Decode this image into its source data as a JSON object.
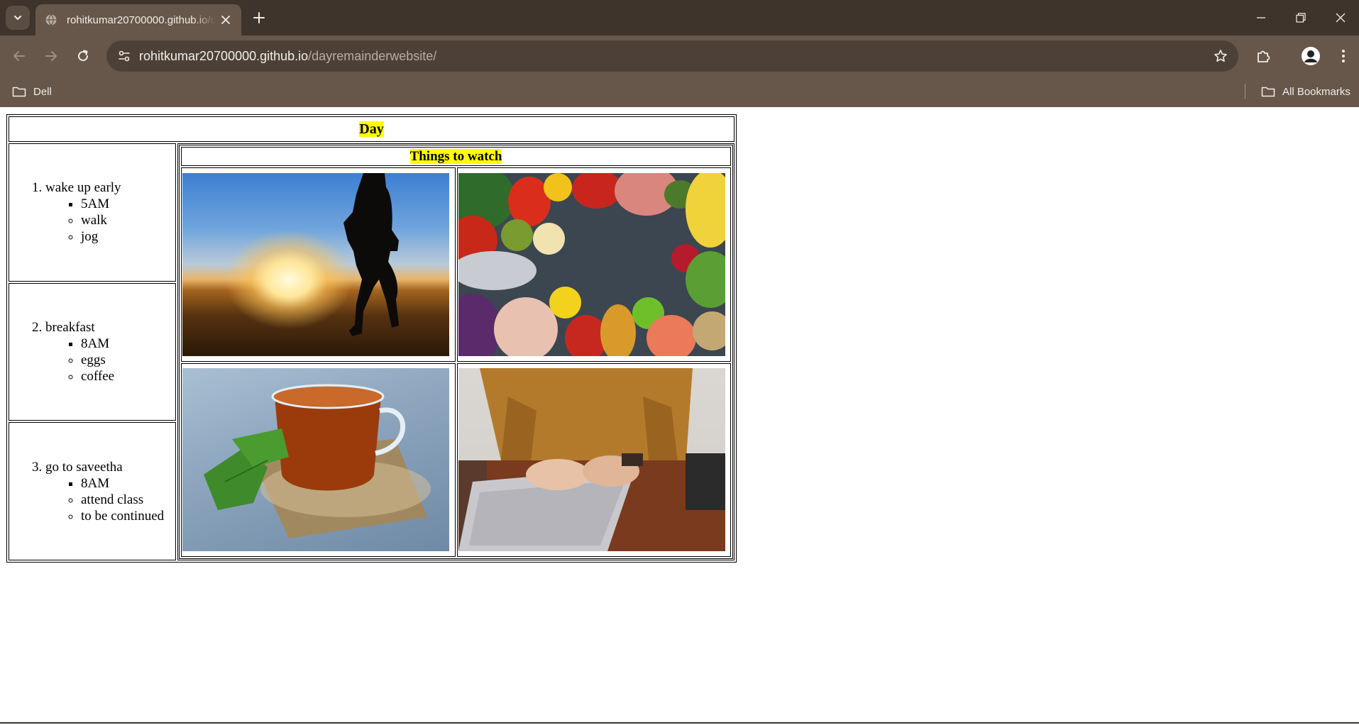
{
  "browser": {
    "tab": {
      "title": "rohitkumar20700000.github.io/dayremainderwebsite/"
    },
    "address_bar": {
      "host": "rohitkumar20700000.github.io",
      "path": "/dayremainderwebsite/"
    },
    "bookmarks": {
      "left_folder": "Dell",
      "right_folder": "All Bookmarks"
    },
    "icons": [
      "tab-search-icon",
      "globe-icon",
      "close-icon",
      "plus-icon",
      "minimize-icon",
      "restore-icon",
      "close-window-icon",
      "back-icon",
      "forward-icon",
      "reload-icon",
      "site-info-icon",
      "star-icon",
      "extensions-icon",
      "profile-icon",
      "menu-icon",
      "folder-icon"
    ]
  },
  "page": {
    "header": "Day",
    "schedule": [
      {
        "number": "1.",
        "title": "wake up early",
        "time": "5AM",
        "items": [
          "walk",
          "jog"
        ]
      },
      {
        "number": "2.",
        "title": "breakfast",
        "time": "8AM",
        "items": [
          "eggs",
          "coffee"
        ]
      },
      {
        "number": "3.",
        "title": "go to saveetha",
        "time": "8AM",
        "items": [
          "attend class",
          "to be continued"
        ]
      }
    ],
    "watch": {
      "header": "Things to watch",
      "images": [
        "sunrise-jog-photo",
        "healthy-food-photo",
        "herbal-tea-photo",
        "laptop-typing-photo"
      ]
    }
  }
}
